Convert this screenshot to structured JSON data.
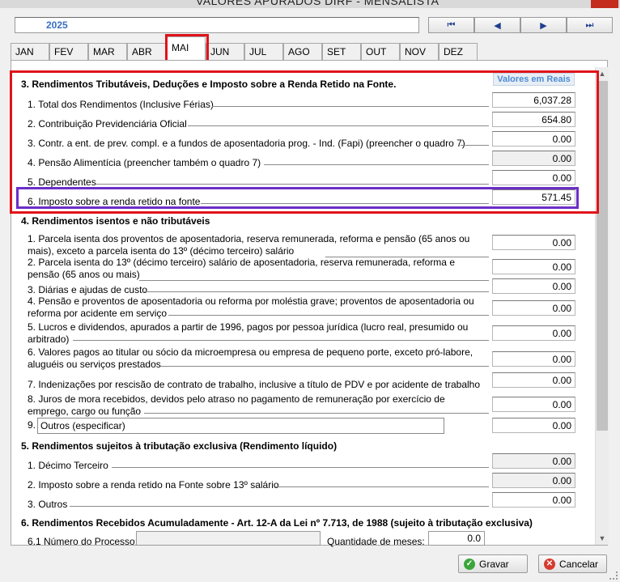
{
  "window": {
    "title": "VALORES APURADOS DIRF - MENSALISTA"
  },
  "year": "2025",
  "nav": {
    "first": "⏮",
    "prev": "◀",
    "next": "▶",
    "last": "⏭"
  },
  "months": [
    "JAN",
    "FEV",
    "MAR",
    "ABR",
    "MAI",
    "JUN",
    "JUL",
    "AGO",
    "SET",
    "OUT",
    "NOV",
    "DEZ"
  ],
  "active_month": "MAI",
  "values_header": "Valores em Reais",
  "s3": {
    "title": "3. Rendimentos Tributáveis, Deduções e Imposto sobre a Renda Retido na Fonte.",
    "items": [
      {
        "label": "1. Total dos Rendimentos (Inclusive Férias)",
        "value": "6,037.28"
      },
      {
        "label": "2. Contribuição Previdenciária Oficial",
        "value": "654.80"
      },
      {
        "label": "3. Contr. a ent. de prev. compl. e a fundos de aposentadoria prog. - Ind. (Fapi) (preencher o quadro 7)",
        "value": "0.00"
      },
      {
        "label": "4. Pensão Alimentícia  (preencher também o quadro 7)",
        "value": "0.00"
      },
      {
        "label": "5. Dependentes",
        "value": "0.00"
      },
      {
        "label": "6. Imposto sobre a renda retido na fonte",
        "value": "571.45"
      }
    ]
  },
  "s4": {
    "title": "4. Rendimentos isentos e não tributáveis",
    "items": [
      {
        "l1": "1. Parcela isenta dos proventos de aposentadoria, reserva remunerada, reforma e pensão (65 anos ou",
        "l2": "mais), exceto a parcela isenta do 13º (décimo terceiro) salário",
        "value": "0.00"
      },
      {
        "l1": "2. Parcela isenta do 13º (décimo terceiro) salário de aposentadoria, reserva remunerada, reforma e",
        "l2": "pensão (65 anos ou mais)",
        "value": "0.00"
      },
      {
        "l1": "3. Diárias e ajudas de custo",
        "l2": "",
        "value": "0.00"
      },
      {
        "l1": "4. Pensão e proventos de aposentadoria ou reforma por moléstia grave; proventos de aposentadoria ou",
        "l2": "reforma por acidente em serviço",
        "value": "0.00"
      },
      {
        "l1": "5. Lucros e dividendos, apurados a partir de 1996, pagos por pessoa jurídica (lucro real, presumido ou",
        "l2": "arbitrado)",
        "value": "0.00"
      },
      {
        "l1": "6. Valores pagos ao titular ou sócio da microempresa ou empresa de pequeno porte, exceto pró-labore,",
        "l2": "aluguéis ou serviços prestados",
        "value": "0.00"
      },
      {
        "l1": "7. Indenizações por rescisão de contrato de trabalho, inclusive a título de PDV e por acidente de trabalho",
        "l2": "",
        "value": "0.00"
      },
      {
        "l1": "8. Juros de mora recebidos, devidos pelo atraso no pagamento de remuneração por exercício de",
        "l2": "emprego, cargo ou função",
        "value": "0.00"
      }
    ],
    "item9": {
      "label": "9.",
      "input": "Outros (especificar)",
      "value": "0.00"
    }
  },
  "s5": {
    "title": "5. Rendimentos sujeitos à tributação exclusiva (Rendimento líquido)",
    "items": [
      {
        "label": "1. Décimo Terceiro",
        "value": "0.00"
      },
      {
        "label": "2. Imposto sobre a renda retido na Fonte sobre 13º salário",
        "value": "0.00"
      },
      {
        "label": "3. Outros",
        "value": "0.00"
      }
    ]
  },
  "s6": {
    "title": "6. Rendimentos Recebidos Acumuladamente - Art. 12-A da Lei nº 7.713, de 1988 (sujeito à tributação exclusiva)",
    "process_label": "6.1 Número do Processo:",
    "months_label": "Quantidade de meses:",
    "months_value": "0.0"
  },
  "buttons": {
    "save": "Gravar",
    "cancel": "Cancelar"
  }
}
